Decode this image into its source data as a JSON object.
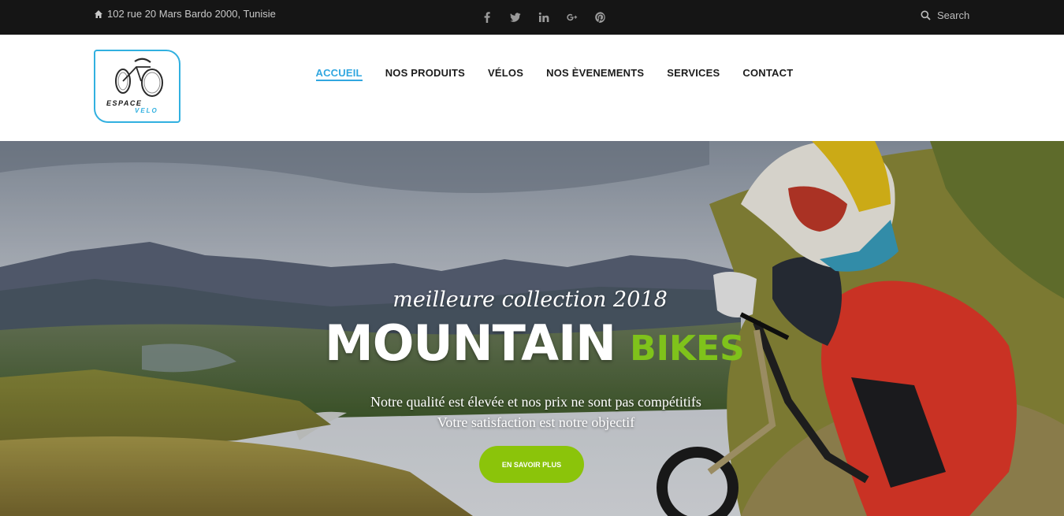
{
  "topbar": {
    "address": "102 rue 20 Mars Bardo 2000, Tunisie",
    "socials": [
      {
        "name": "facebook-icon",
        "glyph": "f"
      },
      {
        "name": "twitter-icon",
        "glyph": "t"
      },
      {
        "name": "linkedin-icon",
        "glyph": "in"
      },
      {
        "name": "google-plus-icon",
        "glyph": "g+"
      },
      {
        "name": "pinterest-icon",
        "glyph": "p"
      }
    ],
    "search_placeholder": "Search"
  },
  "logo": {
    "line1": "ESPACE",
    "line2": "VELO"
  },
  "nav": {
    "items": [
      "ACCUEIL",
      "NOS PRODUITS",
      "VÉLOS",
      "NOS ÈVENEMENTS",
      "SERVICES",
      "CONTACT"
    ],
    "active_index": 0
  },
  "hero": {
    "tagline": "meilleure collection 2018",
    "headline_main": "MOUNTAIN",
    "headline_accent": "BIKES",
    "desc_line1": "Notre qualité est élevée et nos prix ne sont pas compétitifs",
    "desc_line2": "Votre satisfaction est notre objectif",
    "cta": "EN SAVOIR PLUS"
  },
  "colors": {
    "accent_blue": "#31a7e0",
    "accent_green": "#8bc40a",
    "topbar_bg": "#151515"
  }
}
